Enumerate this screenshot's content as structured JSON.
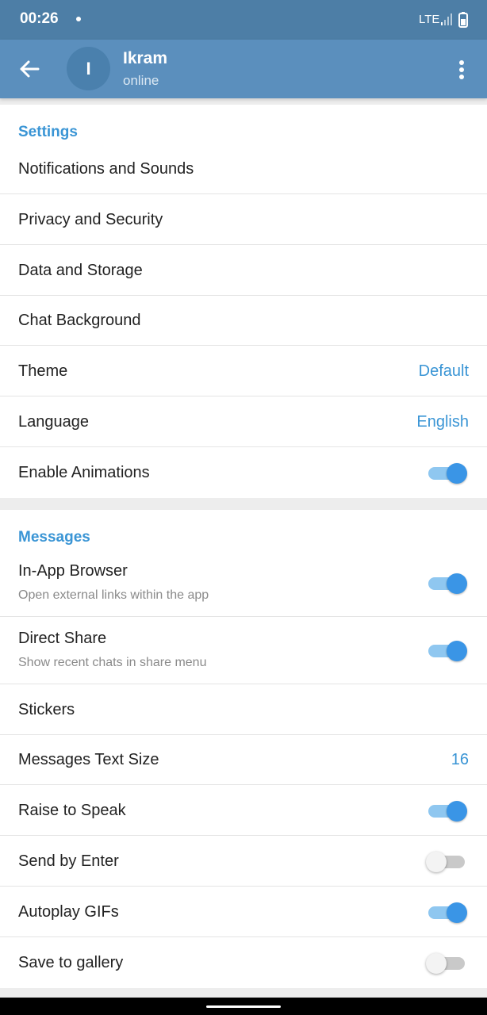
{
  "status_bar": {
    "time": "00:26",
    "network": "LTE"
  },
  "header": {
    "avatar_letter": "I",
    "title": "Ikram",
    "subtitle": "online"
  },
  "settings": {
    "header": "Settings",
    "items": [
      {
        "label": "Notifications and Sounds"
      },
      {
        "label": "Privacy and Security"
      },
      {
        "label": "Data and Storage"
      },
      {
        "label": "Chat Background"
      },
      {
        "label": "Theme",
        "value": "Default"
      },
      {
        "label": "Language",
        "value": "English"
      },
      {
        "label": "Enable Animations",
        "toggle": true
      }
    ]
  },
  "messages": {
    "header": "Messages",
    "items": [
      {
        "label": "In-App Browser",
        "sublabel": "Open external links within the app",
        "toggle": true
      },
      {
        "label": "Direct Share",
        "sublabel": "Show recent chats in share menu",
        "toggle": true
      },
      {
        "label": "Stickers"
      },
      {
        "label": "Messages Text Size",
        "value": "16"
      },
      {
        "label": "Raise to Speak",
        "toggle": true
      },
      {
        "label": "Send by Enter",
        "toggle": false
      },
      {
        "label": "Autoplay GIFs",
        "toggle": true
      },
      {
        "label": "Save to gallery",
        "toggle": false
      }
    ]
  },
  "colors": {
    "status_bar": "#4d7ea6",
    "app_bar": "#5b8fbd",
    "accent": "#3a95d5",
    "toggle_on": "#3a95e6"
  },
  "icons": {
    "back": "arrow-left-icon",
    "more": "more-vertical-icon",
    "signal": "signal-icon",
    "battery": "battery-icon"
  }
}
